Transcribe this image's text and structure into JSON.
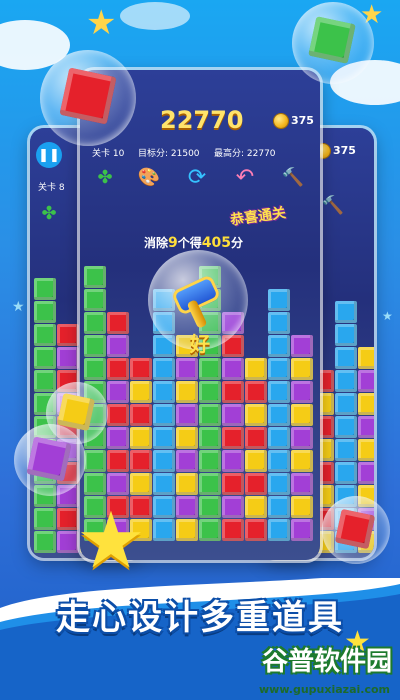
{
  "main": {
    "score": "22770",
    "level_label": "关卡 10",
    "target_label": "目标分: 21500",
    "best_label": "最高分: 22770",
    "coins": "375",
    "combo_text_a": "消除",
    "combo_count": "9",
    "combo_text_b": "个得",
    "combo_points": "405",
    "combo_text_c": "分",
    "congrats": "恭喜通关",
    "praise": "好"
  },
  "left_panel": {
    "level_label": "关卡 8",
    "pause_icon": "pause-icon"
  },
  "right_panel": {
    "coins": "375"
  },
  "tools": [
    "clover-icon",
    "palette-icon",
    "refresh-icon",
    "undo-icon",
    "hammer-icon"
  ],
  "slogan": "走心设计多重道具",
  "watermark": {
    "brand": "谷普软件园",
    "url": "www.gupuxiazai.com"
  },
  "colors": {
    "red": "#e5212b",
    "green": "#3cc24a",
    "yellow": "#f5cc16",
    "purple": "#a23fd6",
    "blue": "#29a7ee",
    "orange": "#f57f17"
  }
}
